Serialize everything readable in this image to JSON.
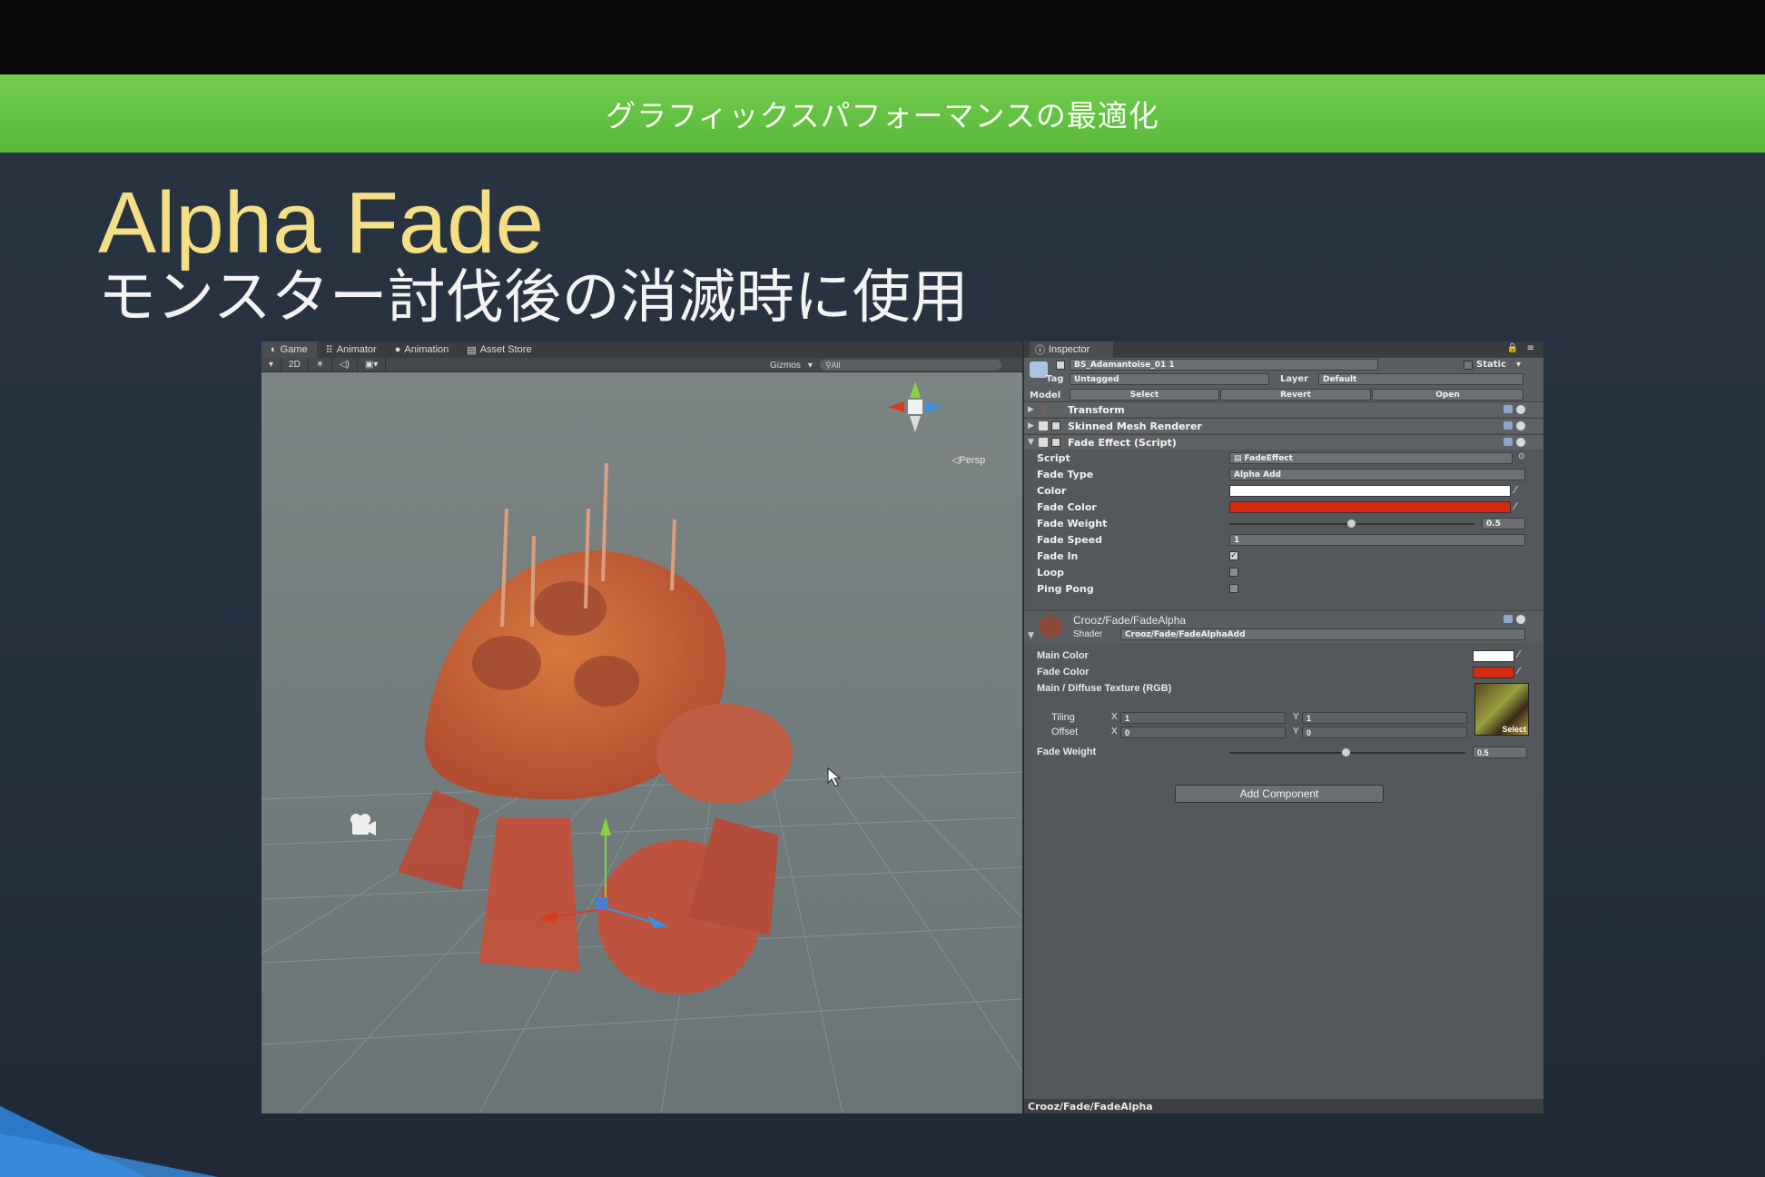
{
  "slide": {
    "banner": "グラフィックスパフォーマンスの最適化",
    "title": "Alpha Fade",
    "subtitle": "モンスター討伐後の消滅時に使用"
  },
  "game_view": {
    "tabs": [
      "Game",
      "Animator",
      "Animation",
      "Asset Store"
    ],
    "toolbar": {
      "mode_2d": "2D",
      "gizmos": "Gizmos",
      "search_placeholder": "All"
    },
    "persp_label": "Persp"
  },
  "inspector": {
    "tab_label": "Inspector",
    "object_name": "BS_Adamantoise_01 1",
    "static_label": "Static",
    "tag_label": "Tag",
    "tag_value": "Untagged",
    "layer_label": "Layer",
    "layer_value": "Default",
    "model_label": "Model",
    "model_buttons": [
      "Select",
      "Revert",
      "Open"
    ],
    "components": [
      "Transform",
      "Skinned Mesh Renderer",
      "Fade Effect (Script)"
    ],
    "fade_effect": {
      "script_label": "Script",
      "script_value": "FadeEffect",
      "fade_type_label": "Fade Type",
      "fade_type_value": "Alpha Add",
      "color_label": "Color",
      "color_value": "#ffffff",
      "fade_color_label": "Fade Color",
      "fade_color_value": "#d42a10",
      "fade_weight_label": "Fade Weight",
      "fade_weight_value": "0.5",
      "fade_speed_label": "Fade Speed",
      "fade_speed_value": "1",
      "fade_in_label": "Fade In",
      "fade_in_checked": true,
      "loop_label": "Loop",
      "loop_checked": false,
      "ping_pong_label": "Ping Pong",
      "ping_pong_checked": false
    },
    "material": {
      "name": "Crooz/Fade/FadeAlpha",
      "shader_label": "Shader",
      "shader_value": "Crooz/Fade/FadeAlphaAdd",
      "main_color_label": "Main Color",
      "fade_color_label": "Fade Color",
      "texture_label": "Main / Diffuse Texture (RGB)",
      "tiling_label": "Tiling",
      "offset_label": "Offset",
      "x_label": "X",
      "y_label": "Y",
      "tiling_x": "1",
      "tiling_y": "1",
      "offset_x": "0",
      "offset_y": "0",
      "select_label": "Select",
      "fade_weight_label": "Fade Weight",
      "fade_weight_value": "0.5"
    },
    "add_component": "Add Component",
    "status": "Crooz/Fade/FadeAlpha"
  }
}
